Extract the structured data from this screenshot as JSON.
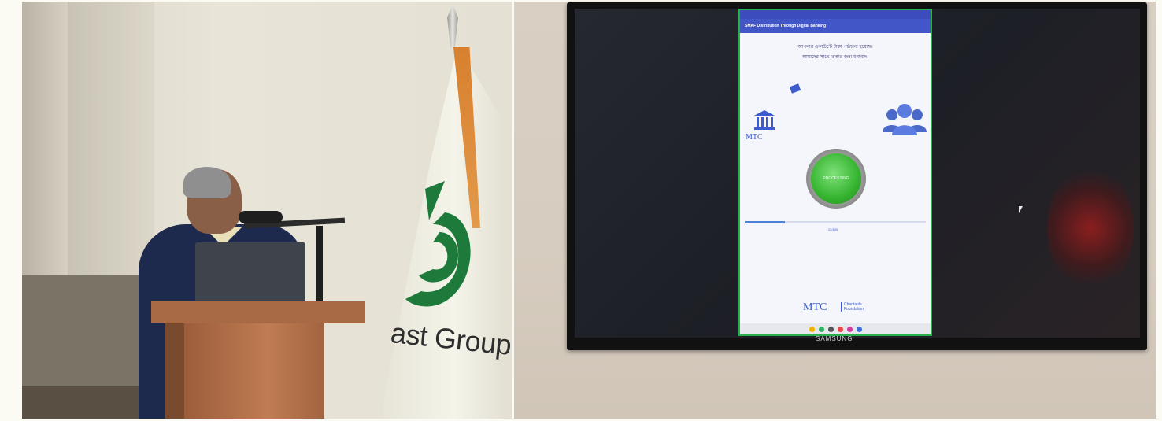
{
  "scene": {
    "flag_text": "ast Group",
    "tv_brand": "SAMSUNG"
  },
  "app": {
    "title": "SMAF Distribution Through Digital Banking",
    "bengali_line_1": "আপনার একাউন্টে টাকা পাঠানো হয়েছে।",
    "bengali_line_2": "আমাদের সাথে থাকার জন্য ধন্যবাদ।",
    "processing_label": "PROCESSING",
    "progress_percent": 22,
    "progress_label": "22/100",
    "brand_small": "MTC",
    "footer_logo": "MTC",
    "footer_sub_1": "Charitable",
    "footer_sub_2": "Foundation"
  },
  "colors": {
    "app_header": "#4356c8",
    "app_border": "#26b24a",
    "processing_button": "#35b42f",
    "podium": "#a86a45",
    "suit": "#1d2a4e"
  }
}
